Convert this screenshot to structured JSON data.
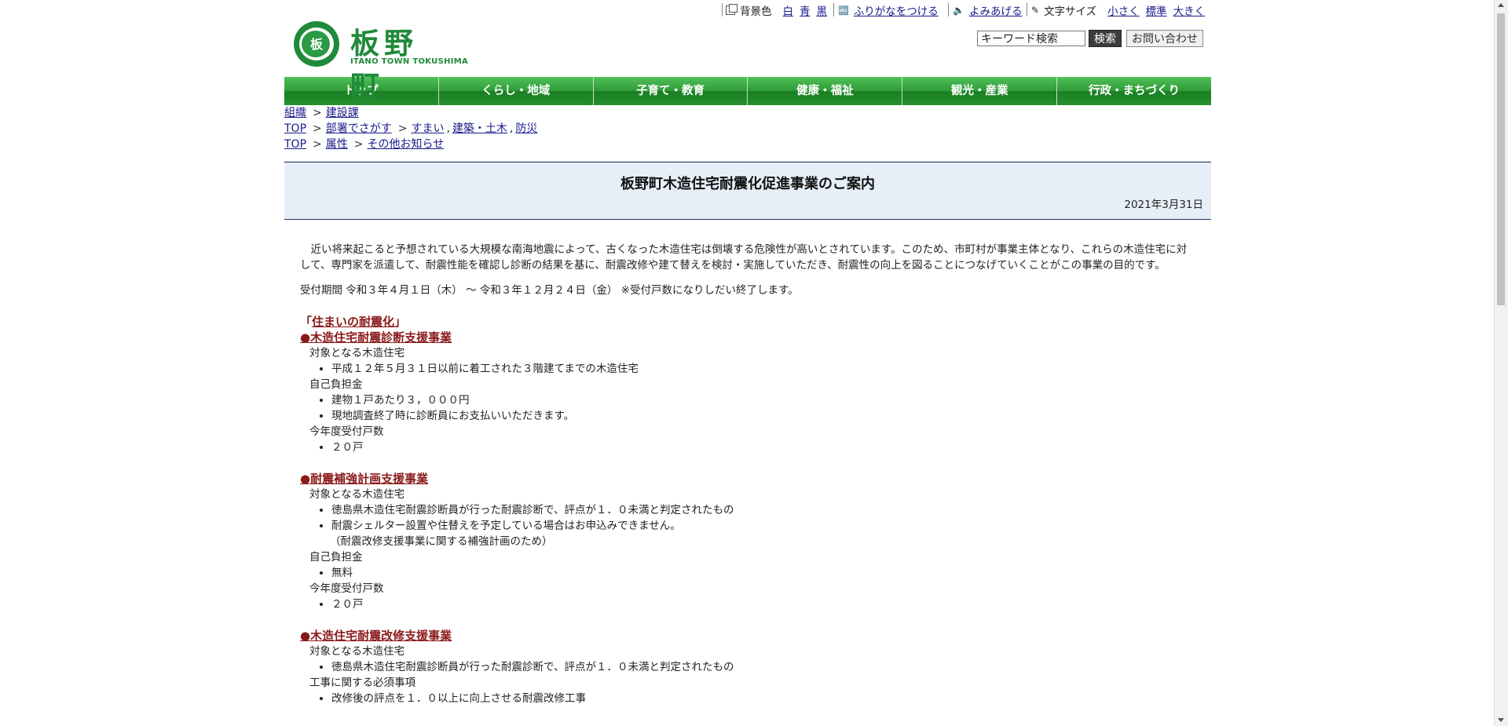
{
  "utility": {
    "bgcolor_label": "背景色",
    "bgcolor_options": [
      "白",
      "青",
      "黒"
    ],
    "furigana_label": "ふりがなをつける",
    "readaloud_label": "よみあげる",
    "fontsize_label": "文字サイズ",
    "fontsize_options": [
      "小さく",
      "標準",
      "大きく"
    ]
  },
  "header": {
    "logo_seal": "板",
    "logo_name": "板野町",
    "logo_sub": "ITANO TOWN TOKUSHIMA",
    "search_placeholder": "キーワード検索",
    "search_button": "検索",
    "contact_button": "お問い合わせ"
  },
  "nav": [
    "トップ",
    "くらし・地域",
    "子育て・教育",
    "健康・福祉",
    "観光・産業",
    "行政・まちづくり"
  ],
  "breadcrumbs": [
    [
      "組織",
      "建設課"
    ],
    [
      "TOP",
      "部署でさがす",
      "すまい",
      "建築・土木",
      "防災"
    ],
    [
      "TOP",
      "属性",
      "その他お知らせ"
    ]
  ],
  "title": "板野町木造住宅耐震化促進事業のご案内",
  "date": "2021年3月31日",
  "intro": "近い将来起こると予想されている大規模な南海地震によって、古くなった木造住宅は倒壊する危険性が高いとされています。このため、市町村が事業主体となり、これらの木造住宅に対して、専門家を派遣して、耐震性能を確認し診断の結果を基に、耐震改修や建て替えを検討・実施していただき、耐震性の向上を図ることにつなげていくことがこの事業の目的です。",
  "period": "受付期間 令和３年４月１日（木） ～ 令和３年１２月２４日（金） ※受付戸数になりしだい終了します。",
  "section_heading": {
    "open": "「",
    "text": "住まいの耐震化",
    "close": "」"
  },
  "programs": [
    {
      "title": "●木造住宅耐震診断支援事業",
      "blocks": [
        {
          "label": "対象となる木造住宅",
          "items": [
            "平成１２年５月３１日以前に着工された３階建てまでの木造住宅"
          ],
          "note": ""
        },
        {
          "label": "自己負担金",
          "items": [
            "建物１戸あたり３，０００円",
            "現地調査終了時に診断員にお支払いいただきます。"
          ],
          "note": ""
        },
        {
          "label": "今年度受付戸数",
          "items": [
            "２０戸"
          ],
          "note": ""
        }
      ]
    },
    {
      "title": "●耐震補強計画支援事業",
      "blocks": [
        {
          "label": "対象となる木造住宅",
          "items": [
            "徳島県木造住宅耐震診断員が行った耐震診断で、評点が１．０未満と判定されたもの",
            "耐震シェルター設置や住替えを予定している場合はお申込みできません。"
          ],
          "note": "（耐震改修支援事業に関する補強計画のため）"
        },
        {
          "label": "自己負担金",
          "items": [
            "無料"
          ],
          "note": ""
        },
        {
          "label": "今年度受付戸数",
          "items": [
            "２０戸"
          ],
          "note": ""
        }
      ]
    },
    {
      "title": "●木造住宅耐震改修支援事業",
      "blocks": [
        {
          "label": "対象となる木造住宅",
          "items": [
            "徳島県木造住宅耐震診断員が行った耐震診断で、評点が１．０未満と判定されたもの"
          ],
          "note": ""
        },
        {
          "label": "工事に関する必須事項",
          "items": [
            "改修後の評点を１．０以上に向上させる耐震改修工事"
          ],
          "note": ""
        }
      ]
    }
  ]
}
